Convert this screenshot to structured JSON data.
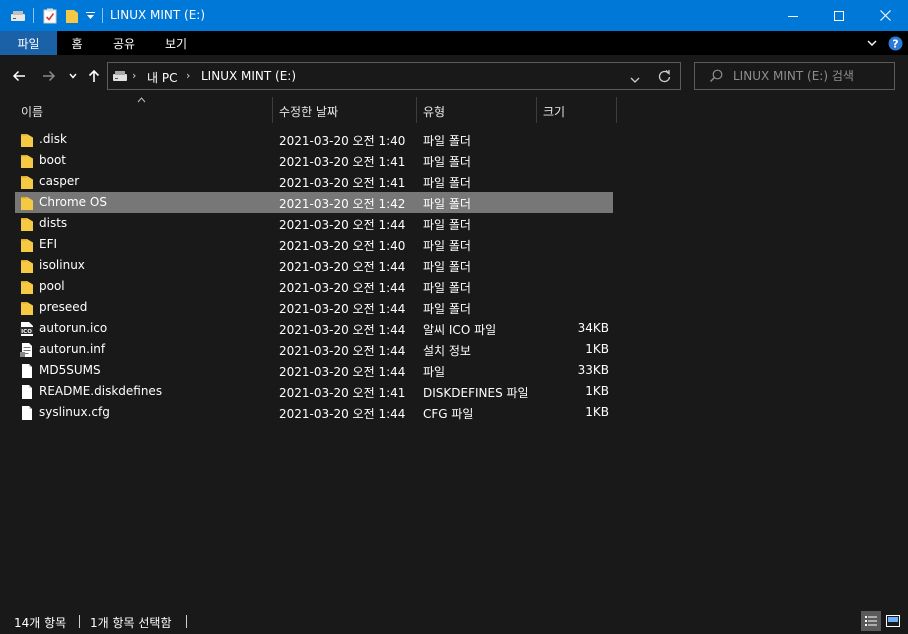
{
  "window": {
    "title": "LINUX MINT (E:)",
    "accent_color": "#0078d7",
    "controls": {
      "minimize_icon": "minimize-icon",
      "maximize_icon": "maximize-icon",
      "close_icon": "close-icon"
    }
  },
  "ribbon": {
    "tabs": [
      "파일",
      "홈",
      "공유",
      "보기"
    ],
    "active_tab": "파일",
    "help_icon": "help-icon"
  },
  "navigation": {
    "breadcrumb": [
      "내 PC",
      "LINUX MINT (E:)"
    ],
    "search_placeholder": "LINUX MINT (E:) 검색"
  },
  "columns": [
    "이름",
    "수정한 날짜",
    "유형",
    "크기"
  ],
  "files": [
    {
      "name": ".disk",
      "modified": "2021-03-20 오전 1:40",
      "type": "파일 폴더",
      "size": "",
      "icon": "folder-icon",
      "selected": false
    },
    {
      "name": "boot",
      "modified": "2021-03-20 오전 1:41",
      "type": "파일 폴더",
      "size": "",
      "icon": "folder-icon",
      "selected": false
    },
    {
      "name": "casper",
      "modified": "2021-03-20 오전 1:41",
      "type": "파일 폴더",
      "size": "",
      "icon": "folder-icon",
      "selected": false
    },
    {
      "name": "Chrome OS",
      "modified": "2021-03-20 오전 1:42",
      "type": "파일 폴더",
      "size": "",
      "icon": "folder-icon",
      "selected": true
    },
    {
      "name": "dists",
      "modified": "2021-03-20 오전 1:44",
      "type": "파일 폴더",
      "size": "",
      "icon": "folder-icon",
      "selected": false
    },
    {
      "name": "EFI",
      "modified": "2021-03-20 오전 1:40",
      "type": "파일 폴더",
      "size": "",
      "icon": "folder-icon",
      "selected": false
    },
    {
      "name": "isolinux",
      "modified": "2021-03-20 오전 1:44",
      "type": "파일 폴더",
      "size": "",
      "icon": "folder-icon",
      "selected": false
    },
    {
      "name": "pool",
      "modified": "2021-03-20 오전 1:44",
      "type": "파일 폴더",
      "size": "",
      "icon": "folder-icon",
      "selected": false
    },
    {
      "name": "preseed",
      "modified": "2021-03-20 오전 1:44",
      "type": "파일 폴더",
      "size": "",
      "icon": "folder-icon",
      "selected": false
    },
    {
      "name": "autorun.ico",
      "modified": "2021-03-20 오전 1:44",
      "type": "알씨 ICO 파일",
      "size": "34KB",
      "icon": "ico-file-icon",
      "selected": false
    },
    {
      "name": "autorun.inf",
      "modified": "2021-03-20 오전 1:44",
      "type": "설치 정보",
      "size": "1KB",
      "icon": "inf-file-icon",
      "selected": false
    },
    {
      "name": "MD5SUMS",
      "modified": "2021-03-20 오전 1:44",
      "type": "파일",
      "size": "33KB",
      "icon": "file-icon",
      "selected": false
    },
    {
      "name": "README.diskdefines",
      "modified": "2021-03-20 오전 1:41",
      "type": "DISKDEFINES 파일",
      "size": "1KB",
      "icon": "file-icon",
      "selected": false
    },
    {
      "name": "syslinux.cfg",
      "modified": "2021-03-20 오전 1:44",
      "type": "CFG 파일",
      "size": "1KB",
      "icon": "file-icon",
      "selected": false
    }
  ],
  "status": {
    "item_count": "14개 항목",
    "selection": "1개 항목 선택함"
  },
  "colors": {
    "background": "#191919",
    "selected_row": "#777777",
    "ribbon_active": "#1a61a8",
    "folder": "#f5c944"
  }
}
